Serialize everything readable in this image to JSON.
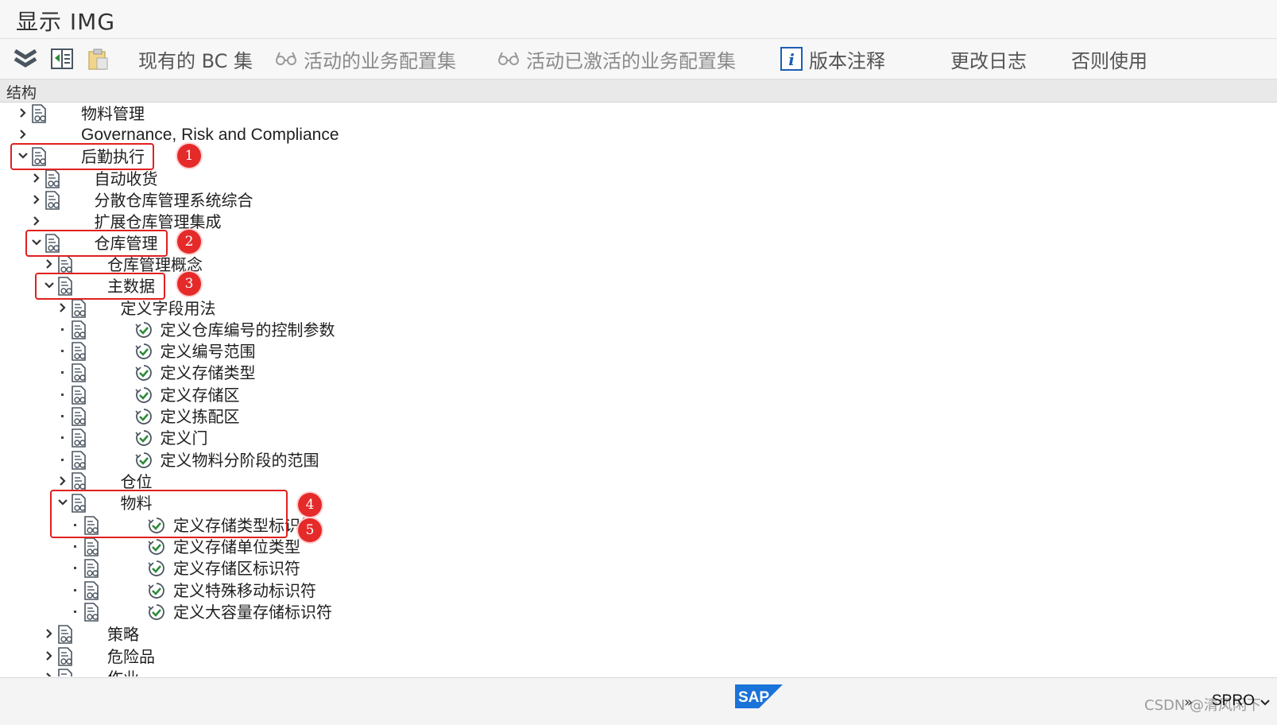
{
  "window": {
    "title": "显示 IMG"
  },
  "toolbar": {
    "items": [
      {
        "label": "现有的 BC 集",
        "enabled": true,
        "icon": "bc-set-icon"
      },
      {
        "label": "活动的业务配置集",
        "enabled": false,
        "icon": "glasses-icon"
      },
      {
        "label": "活动已激活的业务配置集",
        "enabled": false,
        "icon": "glasses-icon"
      },
      {
        "label": "版本注释",
        "enabled": true,
        "icon": "info-icon"
      },
      {
        "label": "更改日志",
        "enabled": true
      },
      {
        "label": "否则使用",
        "enabled": true
      }
    ]
  },
  "structure_header": "结构",
  "tree": [
    {
      "label": "物料管理",
      "state": "collapsed",
      "doc": true,
      "activity": false
    },
    {
      "label": "Governance, Risk and Compliance",
      "state": "collapsed",
      "doc": false,
      "activity": false
    },
    {
      "label": "后勤执行",
      "state": "expanded",
      "doc": true,
      "activity": false,
      "marker": "1"
    },
    {
      "label": "自动收货",
      "state": "collapsed",
      "doc": true,
      "activity": false
    },
    {
      "label": "分散仓库管理系统综合",
      "state": "collapsed",
      "doc": true,
      "activity": false
    },
    {
      "label": "扩展仓库管理集成",
      "state": "collapsed",
      "doc": false,
      "activity": false
    },
    {
      "label": "仓库管理",
      "state": "expanded",
      "doc": true,
      "activity": false,
      "marker": "2"
    },
    {
      "label": "仓库管理概念",
      "state": "collapsed",
      "doc": true,
      "activity": false
    },
    {
      "label": "主数据",
      "state": "expanded",
      "doc": true,
      "activity": false,
      "marker": "3"
    },
    {
      "label": "定义字段用法",
      "state": "collapsed",
      "doc": true,
      "activity": false
    },
    {
      "label": "定义仓库编号的控制参数",
      "state": "leaf",
      "doc": true,
      "activity": true
    },
    {
      "label": "定义编号范围",
      "state": "leaf",
      "doc": true,
      "activity": true
    },
    {
      "label": "定义存储类型",
      "state": "leaf",
      "doc": true,
      "activity": true
    },
    {
      "label": "定义存储区",
      "state": "leaf",
      "doc": true,
      "activity": true
    },
    {
      "label": "定义拣配区",
      "state": "leaf",
      "doc": true,
      "activity": true
    },
    {
      "label": "定义门",
      "state": "leaf",
      "doc": true,
      "activity": true
    },
    {
      "label": "定义物料分阶段的范围",
      "state": "leaf",
      "doc": true,
      "activity": true
    },
    {
      "label": "仓位",
      "state": "collapsed",
      "doc": true,
      "activity": false
    },
    {
      "label": "物料",
      "state": "expanded",
      "doc": true,
      "activity": false,
      "marker": "4"
    },
    {
      "label": "定义存储类型标识符",
      "state": "leaf",
      "doc": true,
      "activity": true,
      "marker": "5"
    },
    {
      "label": "定义存储单位类型",
      "state": "leaf",
      "doc": true,
      "activity": true
    },
    {
      "label": "定义存储区标识符",
      "state": "leaf",
      "doc": true,
      "activity": true
    },
    {
      "label": "定义特殊移动标识符",
      "state": "leaf",
      "doc": true,
      "activity": true
    },
    {
      "label": "定义大容量存储标识符",
      "state": "leaf",
      "doc": true,
      "activity": true
    },
    {
      "label": "策略",
      "state": "collapsed",
      "doc": true,
      "activity": false
    },
    {
      "label": "危险品",
      "state": "collapsed",
      "doc": true,
      "activity": false
    },
    {
      "label": "作业",
      "state": "collapsed",
      "doc": true,
      "activity": false
    }
  ],
  "statusbar": {
    "logo": "SAP",
    "watermark": "CSDN @清风闲下",
    "separator": "»",
    "transaction": "SPRO"
  },
  "colors": {
    "highlight": "#e02020",
    "activity_green": "#2e8b3a",
    "info_blue": "#1a5fb4"
  }
}
